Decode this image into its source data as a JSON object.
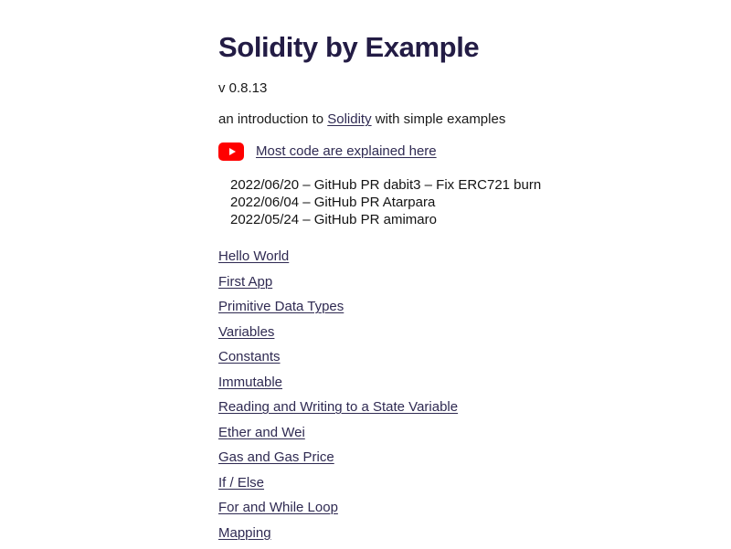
{
  "header": {
    "title": "Solidity by Example",
    "version": "v 0.8.13"
  },
  "intro": {
    "prefix": "an introduction to ",
    "link_label": "Solidity",
    "suffix": " with simple examples"
  },
  "video": {
    "icon": "youtube-icon",
    "icon_color": "#ff0000",
    "link_label": "Most code are explained here"
  },
  "changelog": [
    "2022/06/20 – GitHub PR dabit3 – Fix ERC721 burn",
    "2022/06/04 – GitHub PR Atarpara",
    "2022/05/24 – GitHub PR amimaro"
  ],
  "toc": [
    {
      "label": "Hello World"
    },
    {
      "label": "First App"
    },
    {
      "label": "Primitive Data Types"
    },
    {
      "label": "Variables"
    },
    {
      "label": "Constants"
    },
    {
      "label": "Immutable"
    },
    {
      "label": "Reading and Writing to a State Variable"
    },
    {
      "label": "Ether and Wei"
    },
    {
      "label": "Gas and Gas Price"
    },
    {
      "label": "If / Else"
    },
    {
      "label": "For and While Loop"
    },
    {
      "label": "Mapping"
    }
  ],
  "colors": {
    "background": "#ffffff",
    "title": "#231c45",
    "link": "#2f2a52",
    "body_text": "#1a1a1a",
    "accent_red": "#ff0000"
  }
}
